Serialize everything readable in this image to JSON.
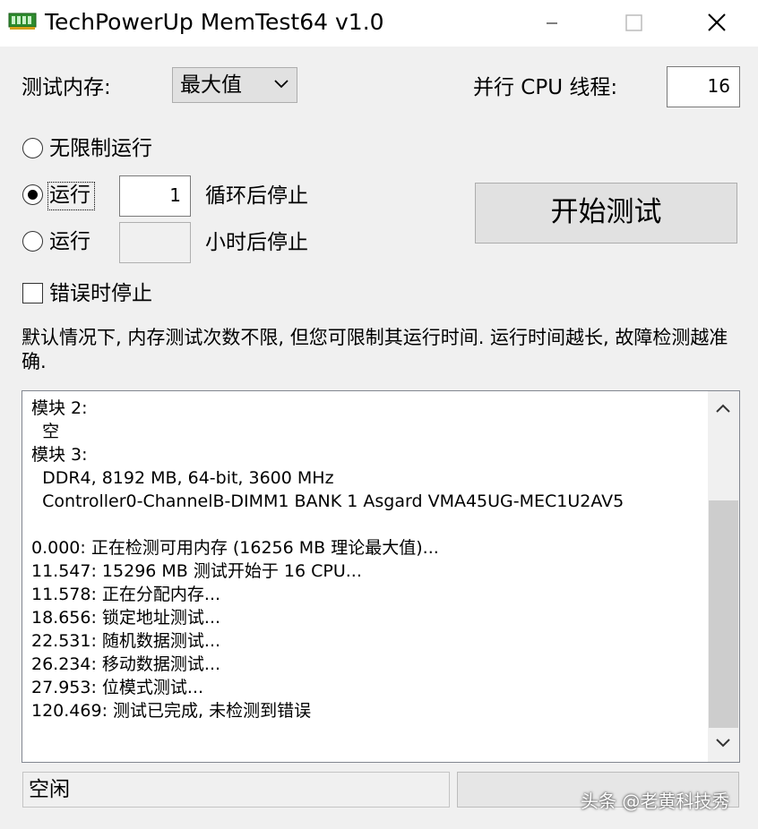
{
  "window": {
    "title": "TechPowerUp MemTest64 v1.0",
    "icon": "memory-module-icon",
    "controls": [
      "minimize-icon",
      "maximize-icon",
      "close-icon"
    ]
  },
  "settings": {
    "test_memory_label": "测试内存:",
    "memory_select_value": "最大值",
    "cpu_threads_label": "并行 CPU 线程:",
    "cpu_threads_value": "16"
  },
  "run_options": {
    "unlimited_label": "无限制运行",
    "run_cycles_label": "运行",
    "cycles_value": "1",
    "cycles_suffix": "循环后停止",
    "run_hours_label": "运行",
    "hours_value": "",
    "hours_suffix": "小时后停止",
    "stop_on_error_label": "错误时停止",
    "selected": "cycles",
    "stop_on_error_checked": false
  },
  "start_button": "开始测试",
  "description": "默认情况下, 内存测试次数不限, 但您可限制其运行时间. 运行时间越长, 故障检测越准确.",
  "log": [
    "模块 2:",
    "  空",
    "模块 3:",
    "  DDR4, 8192 MB, 64-bit, 3600 MHz",
    "  Controller0-ChannelB-DIMM1 BANK 1 Asgard VMA45UG-MEC1U2AV5",
    "",
    "0.000: 正在检测可用内存 (16256 MB 理论最大值)...",
    "11.547: 15296 MB 测试开始于 16 CPU...",
    "11.578: 正在分配内存...",
    "18.656: 锁定地址测试...",
    "22.531: 随机数据测试...",
    "26.234: 移动数据测试...",
    "27.953: 位模式测试...",
    "120.469: 测试已完成, 未检测到错误"
  ],
  "status": "空闲",
  "watermark": "头条 @老黄科技秀",
  "colors": {
    "window_bg": "#f0f0f0",
    "titlebar_bg": "#ffffff",
    "button_bg": "#e1e1e1",
    "icon_green": "#2e8b2e"
  }
}
